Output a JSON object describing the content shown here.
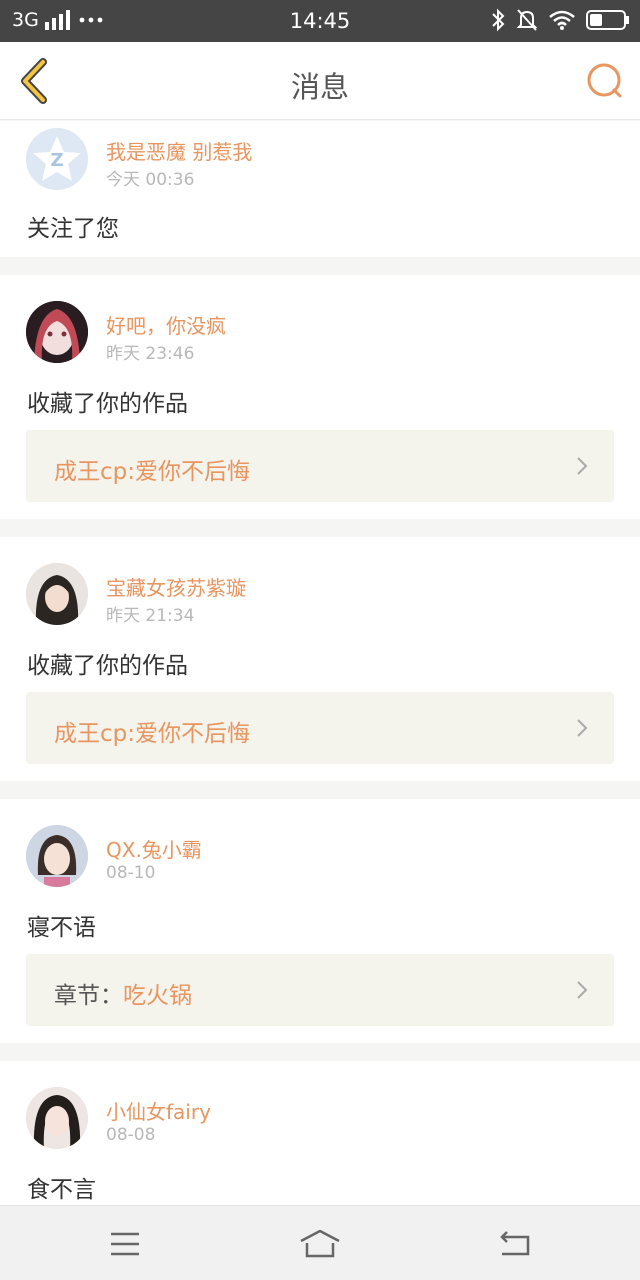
{
  "status_bar": {
    "network": "3G",
    "time": "14:45"
  },
  "header": {
    "title": "消息"
  },
  "colors": {
    "accent": "#e8955f",
    "back_arrow": "#f5c542",
    "link_bg": "#f4f3ec"
  },
  "messages": [
    {
      "name": "我是恶魔 别惹我",
      "time": "今天 00:36",
      "action": "关注了您"
    },
    {
      "name": "好吧，你没疯",
      "time": "昨天 23:46",
      "action": "收藏了你的作品",
      "link": "成王cp:爱你不后悔"
    },
    {
      "name": "宝藏女孩苏紫璇",
      "time": "昨天 21:34",
      "action": "收藏了你的作品",
      "link": "成王cp:爱你不后悔"
    },
    {
      "name": "QX.兔小霸",
      "time": "08-10",
      "action": "寝不语",
      "link_prefix": "章节：",
      "link": "吃火锅"
    },
    {
      "name": "小仙女fairy",
      "time": "08-08",
      "action": "食不言"
    }
  ],
  "icons": {
    "back": "chevron-left-icon",
    "search": "search-icon",
    "menu": "menu-icon",
    "home": "home-icon",
    "return": "return-icon"
  }
}
